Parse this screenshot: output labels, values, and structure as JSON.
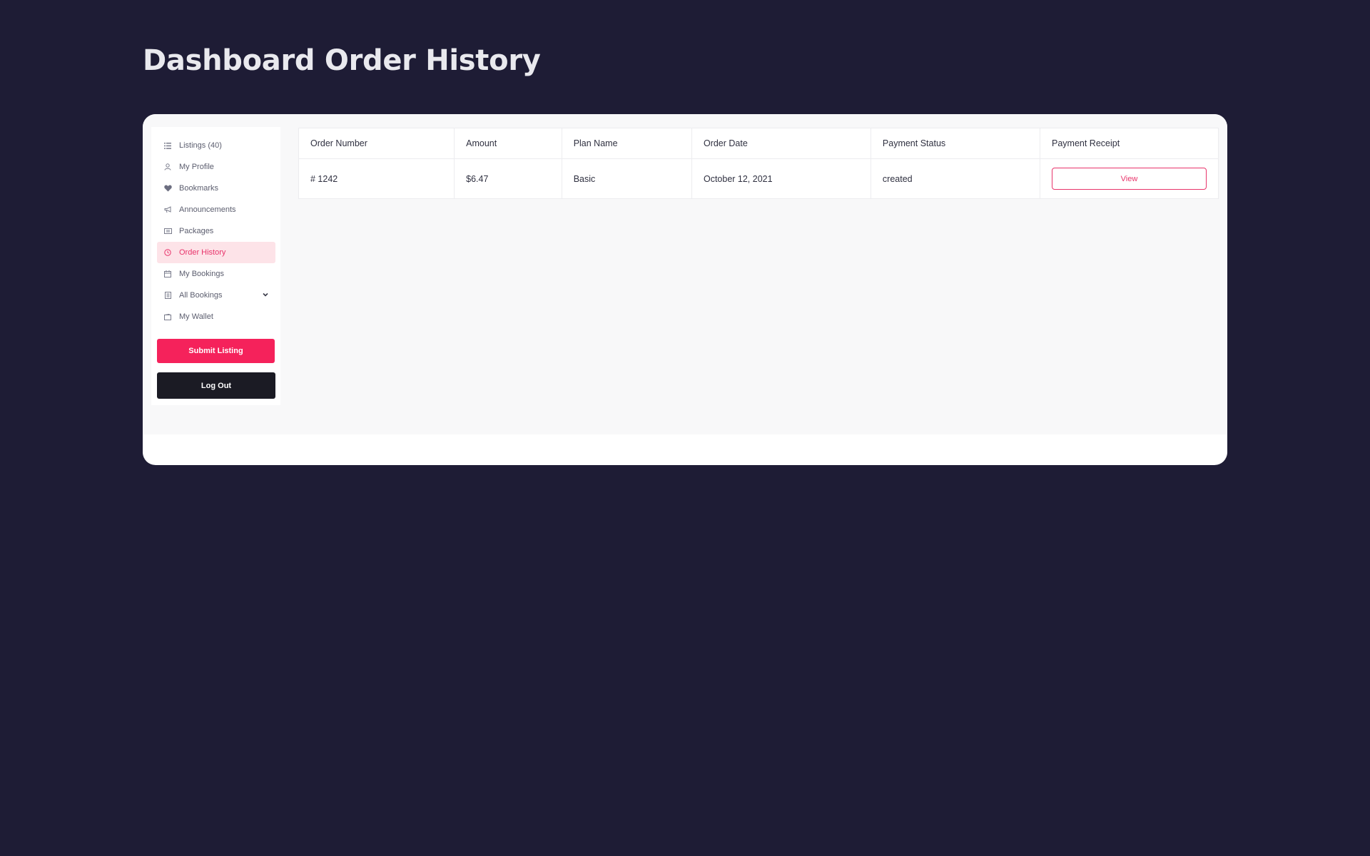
{
  "page": {
    "title": "Dashboard Order History"
  },
  "sidebar": {
    "items": [
      {
        "label": "Listings (40)",
        "icon": "list-icon",
        "active": false
      },
      {
        "label": "My Profile",
        "icon": "user-icon",
        "active": false
      },
      {
        "label": "Bookmarks",
        "icon": "heart-icon",
        "active": false
      },
      {
        "label": "Announcements",
        "icon": "megaphone-icon",
        "active": false
      },
      {
        "label": "Packages",
        "icon": "ticket-icon",
        "active": false
      },
      {
        "label": "Order History",
        "icon": "clock-icon",
        "active": true
      },
      {
        "label": "My Bookings",
        "icon": "calendar-icon",
        "active": false
      },
      {
        "label": "All Bookings",
        "icon": "document-icon",
        "active": false,
        "has_dropdown": true
      },
      {
        "label": "My Wallet",
        "icon": "wallet-icon",
        "active": false
      }
    ],
    "submit_label": "Submit Listing",
    "logout_label": "Log Out"
  },
  "orders": {
    "columns": [
      "Order Number",
      "Amount",
      "Plan Name",
      "Order Date",
      "Payment Status",
      "Payment Receipt"
    ],
    "rows": [
      {
        "order_number": "# 1242",
        "amount": "$6.47",
        "plan_name": "Basic",
        "order_date": "October 12, 2021",
        "payment_status": "created",
        "receipt_label": "View"
      }
    ]
  },
  "colors": {
    "background": "#1e1c35",
    "accent": "#f5225b",
    "active_bg": "#fde3e8",
    "active_text": "#e8346b",
    "logout_bg": "#1b1b24"
  }
}
